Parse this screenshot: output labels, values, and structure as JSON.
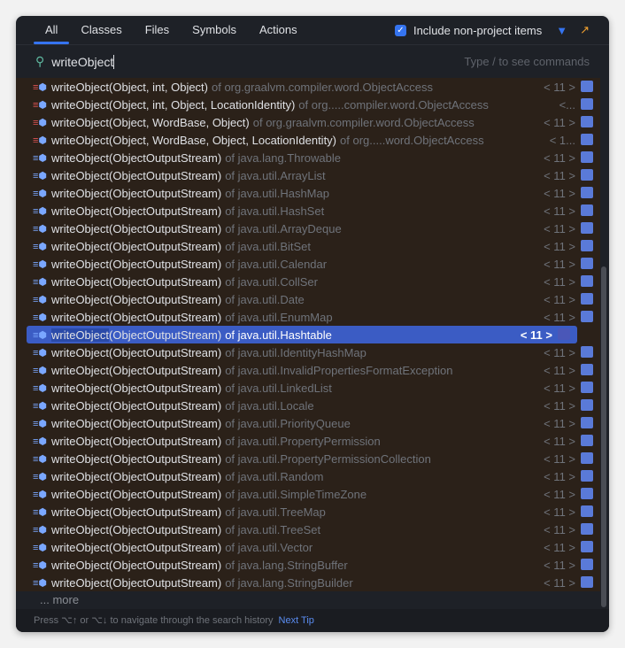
{
  "tabs": [
    {
      "label": "All"
    },
    {
      "label": "Classes"
    },
    {
      "label": "Files"
    },
    {
      "label": "Symbols"
    },
    {
      "label": "Actions"
    }
  ],
  "include_label": "Include non-project items",
  "include_checked": true,
  "search": {
    "value": "writeObject",
    "placeholder": "Type / to see commands"
  },
  "results": [
    {
      "name": "writeObject(Object, int, Object)",
      "of": "of org.graalvm.compiler.word.ObjectAccess",
      "ver": "< 11 >"
    },
    {
      "name": "writeObject(Object, int, Object, LocationIdentity)",
      "of": "of org.....compiler.word.ObjectAccess",
      "ver": "<..."
    },
    {
      "name": "writeObject(Object, WordBase, Object)",
      "of": "of org.graalvm.compiler.word.ObjectAccess",
      "ver": "< 11 >"
    },
    {
      "name": "writeObject(Object, WordBase, Object, LocationIdentity)",
      "of": "of org.....word.ObjectAccess",
      "ver": "< 1..."
    },
    {
      "name": "writeObject(ObjectOutputStream)",
      "of": "of java.lang.Throwable",
      "ver": "< 11 >"
    },
    {
      "name": "writeObject(ObjectOutputStream)",
      "of": "of java.util.ArrayList",
      "ver": "< 11 >"
    },
    {
      "name": "writeObject(ObjectOutputStream)",
      "of": "of java.util.HashMap",
      "ver": "< 11 >"
    },
    {
      "name": "writeObject(ObjectOutputStream)",
      "of": "of java.util.HashSet",
      "ver": "< 11 >"
    },
    {
      "name": "writeObject(ObjectOutputStream)",
      "of": "of java.util.ArrayDeque",
      "ver": "< 11 >"
    },
    {
      "name": "writeObject(ObjectOutputStream)",
      "of": "of java.util.BitSet",
      "ver": "< 11 >"
    },
    {
      "name": "writeObject(ObjectOutputStream)",
      "of": "of java.util.Calendar",
      "ver": "< 11 >"
    },
    {
      "name": "writeObject(ObjectOutputStream)",
      "of": "of java.util.CollSer",
      "ver": "< 11 >"
    },
    {
      "name": "writeObject(ObjectOutputStream)",
      "of": "of java.util.Date",
      "ver": "< 11 >"
    },
    {
      "name": "writeObject(ObjectOutputStream)",
      "of": "of java.util.EnumMap",
      "ver": "< 11 >"
    },
    {
      "name": "writeObject(ObjectOutputStream)",
      "of": "of java.util.Hashtable",
      "ver": "< 11 >",
      "selected": true
    },
    {
      "name": "writeObject(ObjectOutputStream)",
      "of": "of java.util.IdentityHashMap",
      "ver": "< 11 >"
    },
    {
      "name": "writeObject(ObjectOutputStream)",
      "of": "of java.util.InvalidPropertiesFormatException",
      "ver": "< 11 >"
    },
    {
      "name": "writeObject(ObjectOutputStream)",
      "of": "of java.util.LinkedList",
      "ver": "< 11 >"
    },
    {
      "name": "writeObject(ObjectOutputStream)",
      "of": "of java.util.Locale",
      "ver": "< 11 >"
    },
    {
      "name": "writeObject(ObjectOutputStream)",
      "of": "of java.util.PriorityQueue",
      "ver": "< 11 >"
    },
    {
      "name": "writeObject(ObjectOutputStream)",
      "of": "of java.util.PropertyPermission",
      "ver": "< 11 >"
    },
    {
      "name": "writeObject(ObjectOutputStream)",
      "of": "of java.util.PropertyPermissionCollection",
      "ver": "< 11 >"
    },
    {
      "name": "writeObject(ObjectOutputStream)",
      "of": "of java.util.Random",
      "ver": "< 11 >"
    },
    {
      "name": "writeObject(ObjectOutputStream)",
      "of": "of java.util.SimpleTimeZone",
      "ver": "< 11 >"
    },
    {
      "name": "writeObject(ObjectOutputStream)",
      "of": "of java.util.TreeMap",
      "ver": "< 11 >"
    },
    {
      "name": "writeObject(ObjectOutputStream)",
      "of": "of java.util.TreeSet",
      "ver": "< 11 >"
    },
    {
      "name": "writeObject(ObjectOutputStream)",
      "of": "of java.util.Vector",
      "ver": "< 11 >"
    },
    {
      "name": "writeObject(ObjectOutputStream)",
      "of": "of java.lang.StringBuffer",
      "ver": "< 11 >"
    },
    {
      "name": "writeObject(ObjectOutputStream)",
      "of": "of java.lang.StringBuilder",
      "ver": "< 11 >"
    }
  ],
  "more": "... more",
  "footer": {
    "tip": "Press ⌥↑ or ⌥↓ to navigate through the search history",
    "next": "Next Tip"
  },
  "colors": {
    "accent": "#3574f0",
    "selection": "#3b5cc4",
    "list_bg": "#2b2119"
  }
}
